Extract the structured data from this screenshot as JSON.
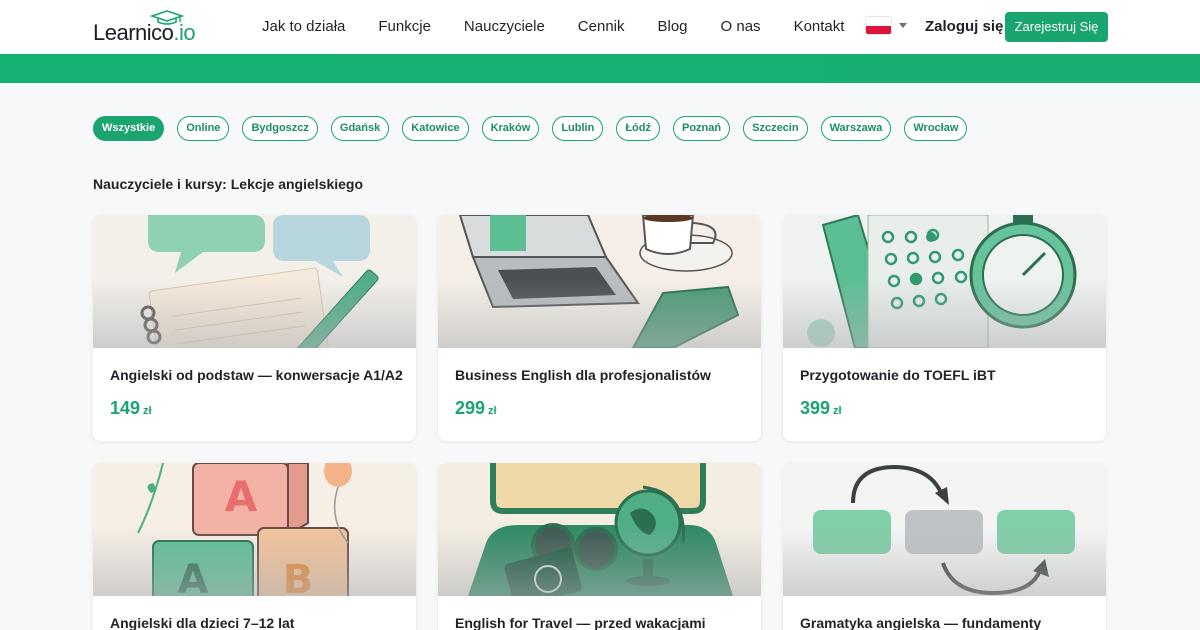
{
  "header": {
    "logo_text": "Learnico",
    "logo_suffix": ".io",
    "nav": [
      "Jak to działa",
      "Funkcje",
      "Nauczyciele",
      "Cennik",
      "Blog",
      "O nas",
      "Kontakt"
    ],
    "login_label": "Zaloguj się",
    "signup_label": "Zarejestruj Się"
  },
  "filters": {
    "items": [
      "Wszystkie",
      "Online",
      "Bydgoszcz",
      "Gdańsk",
      "Katowice",
      "Kraków",
      "Lublin",
      "Łódź",
      "Poznań",
      "Szczecin",
      "Warszawa",
      "Wrocław"
    ],
    "active": "Wszystkie"
  },
  "section": {
    "title": "Nauczyciele i kursy: Lekcje angielskiego"
  },
  "courses": [
    {
      "title": "Angielski od podstaw — konwersacje A1/A2",
      "price": "149",
      "currency": "zł",
      "image": "speech-bubbles-notebook"
    },
    {
      "title": "Business English dla profesjonalistów",
      "price": "299",
      "currency": "zł",
      "image": "laptop-coffee"
    },
    {
      "title": "Przygotowanie do TOEFL iBT",
      "price": "399",
      "currency": "zł",
      "image": "stopwatch-answer-sheet"
    },
    {
      "title": "Angielski dla dzieci 7–12 lat",
      "price": "",
      "currency": "",
      "image": "alphabet-blocks"
    },
    {
      "title": "English for Travel — przed wakacjami",
      "price": "",
      "currency": "",
      "image": "globe-passport"
    },
    {
      "title": "Gramatyka angielska — fundamenty",
      "price": "",
      "currency": "",
      "image": "grammar-flow"
    }
  ],
  "colors": {
    "brand": "#1aa56f",
    "band": "#16b274",
    "background": "#f7f8f9"
  }
}
